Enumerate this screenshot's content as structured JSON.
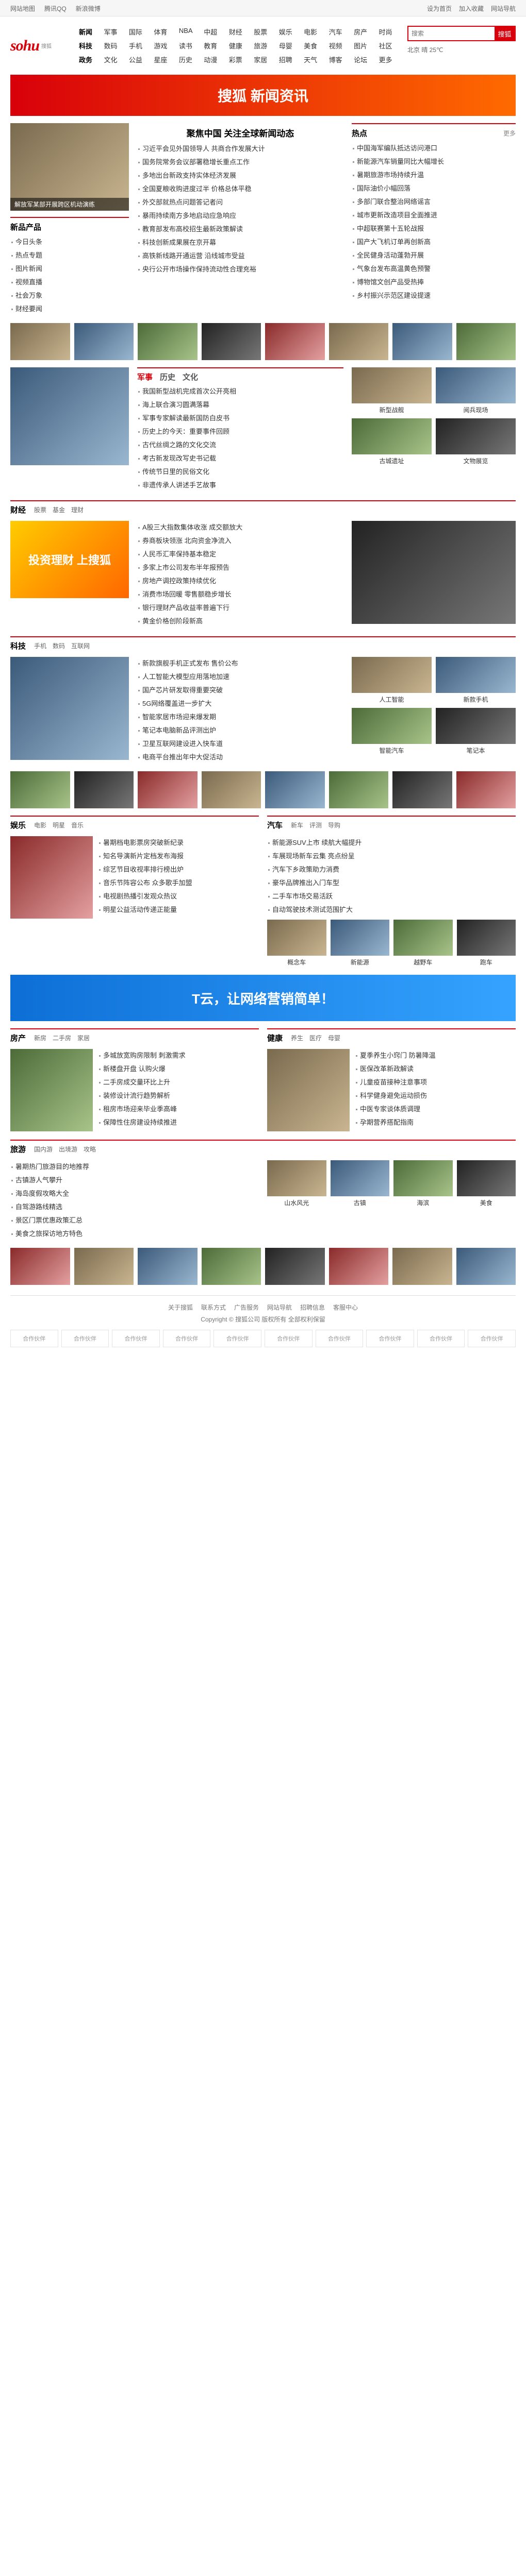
{
  "topbar": {
    "links": [
      "网站地图",
      "腾讯QQ",
      "新浪微博"
    ],
    "right": [
      "设为首页",
      "加入收藏",
      "网站导航"
    ]
  },
  "logo": {
    "mark": "sohu",
    "sub": "搜狐"
  },
  "nav": {
    "items": [
      "新闻",
      "军事",
      "国际",
      "体育",
      "NBA",
      "中超",
      "财经",
      "股票",
      "娱乐",
      "电影",
      "汽车",
      "房产",
      "时尚",
      "科技",
      "数码",
      "手机",
      "游戏",
      "读书",
      "教育",
      "健康",
      "旅游",
      "母婴",
      "美食",
      "视频",
      "图片",
      "社区",
      "政务",
      "文化",
      "公益",
      "星座",
      "历史",
      "动漫",
      "彩票",
      "家居",
      "招聘",
      "天气",
      "博客",
      "论坛",
      "更多"
    ]
  },
  "search": {
    "placeholder": "搜索",
    "button": "搜狐"
  },
  "weather": "北京 晴 25℃",
  "banner": "搜狐 新闻资讯",
  "top": {
    "focus_caption": "解放军某部开展跨区机动演练",
    "products_title": "新品产品",
    "left_links": [
      "今日头条",
      "热点专题",
      "图片新闻",
      "视频直播",
      "社会万象",
      "财经要闻"
    ],
    "headline": "聚焦中国 关注全球新闻动态",
    "news": [
      "习近平会见外国领导人 共商合作发展大计",
      "国务院常务会议部署稳增长重点工作",
      "多地出台新政支持实体经济发展",
      "全国夏粮收购进度过半 价格总体平稳",
      "外交部就热点问题答记者问",
      "暴雨持续南方多地启动应急响应",
      "教育部发布高校招生最新政策解读",
      "科技创新成果展在京开幕",
      "高铁新线路开通运营 沿线城市受益",
      "央行公开市场操作保持流动性合理充裕"
    ],
    "right_title": "热点",
    "right_more": "更多",
    "right_news": [
      "中国海军编队抵达访问港口",
      "新能源汽车销量同比大幅增长",
      "暑期旅游市场持续升温",
      "国际油价小幅回落",
      "多部门联合整治网络谣言",
      "城市更新改造项目全面推进",
      "中超联赛第十五轮战报",
      "国产大飞机订单再创新高",
      "全民健身活动蓬勃开展",
      "气象台发布高温黄色预警",
      "博物馆文创产品受热捧",
      "乡村振兴示范区建设提速"
    ]
  },
  "sec2": {
    "tabs": [
      "军事",
      "历史",
      "文化"
    ],
    "news": [
      "我国新型战机完成首次公开亮相",
      "海上联合演习圆满落幕",
      "军事专家解读最新国防白皮书",
      "历史上的今天：重要事件回顾",
      "古代丝绸之路的文化交流",
      "考古新发现改写史书记载",
      "传统节日里的民俗文化",
      "非遗传承人讲述手艺故事"
    ],
    "thumbs": [
      "新型战舰",
      "阅兵现场",
      "古城遗址",
      "文物展览"
    ]
  },
  "sec3": {
    "title": "财经",
    "tabs": [
      "股票",
      "基金",
      "理财"
    ],
    "news": [
      "A股三大指数集体收涨 成交额放大",
      "券商板块领涨 北向资金净流入",
      "人民币汇率保持基本稳定",
      "多家上市公司发布半年报预告",
      "房地产调控政策持续优化",
      "消费市场回暖 零售额稳步增长",
      "银行理财产品收益率普遍下行",
      "黄金价格创阶段新高"
    ],
    "ad": "投资理财 上搜狐"
  },
  "sec4": {
    "title": "科技",
    "tabs": [
      "手机",
      "数码",
      "互联网"
    ],
    "news": [
      "新款旗舰手机正式发布 售价公布",
      "人工智能大模型应用落地加速",
      "国产芯片研发取得重要突破",
      "5G网络覆盖进一步扩大",
      "智能家居市场迎来爆发期",
      "笔记本电脑新品评测出炉",
      "卫星互联网建设进入快车道",
      "电商平台推出年中大促活动"
    ],
    "thumbs": [
      "人工智能",
      "新款手机",
      "智能汽车",
      "笔记本"
    ]
  },
  "sec5": {
    "title": "娱乐",
    "tabs": [
      "电影",
      "明星",
      "音乐"
    ],
    "news": [
      "暑期档电影票房突破新纪录",
      "知名导演新片定档发布海报",
      "综艺节目收视率排行榜出炉",
      "音乐节阵容公布 众多歌手加盟",
      "电视剧热播引发观众热议",
      "明星公益活动传递正能量"
    ]
  },
  "sec6": {
    "title": "汽车",
    "tabs": [
      "新车",
      "评测",
      "导购"
    ],
    "news": [
      "新能源SUV上市 续航大幅提升",
      "车展现场新车云集 亮点纷呈",
      "汽车下乡政策助力消费",
      "豪华品牌推出入门车型",
      "二手车市场交易活跃",
      "自动驾驶技术测试范围扩大"
    ],
    "thumbs": [
      "概念车",
      "新能源",
      "越野车",
      "跑车"
    ]
  },
  "adbox": "T云，让网络营销简单！",
  "sec7": {
    "title": "房产",
    "tabs": [
      "新房",
      "二手房",
      "家居"
    ],
    "news": [
      "多城放宽购房限制 刺激需求",
      "新楼盘开盘 认购火爆",
      "二手房成交量环比上升",
      "装修设计流行趋势解析",
      "租房市场迎来毕业季高峰",
      "保障性住房建设持续推进"
    ]
  },
  "sec8": {
    "title": "健康",
    "tabs": [
      "养生",
      "医疗",
      "母婴"
    ],
    "news": [
      "夏季养生小窍门 防暑降温",
      "医保改革新政解读",
      "儿童疫苗接种注意事项",
      "科学健身避免运动损伤",
      "中医专家谈体质调理",
      "孕期营养搭配指南"
    ]
  },
  "sec9": {
    "title": "旅游",
    "tabs": [
      "国内游",
      "出境游",
      "攻略"
    ],
    "news": [
      "暑期热门旅游目的地推荐",
      "古镇游人气攀升",
      "海岛度假攻略大全",
      "自驾游路线精选",
      "景区门票优惠政策汇总",
      "美食之旅探访地方特色"
    ],
    "thumbs": [
      "山水风光",
      "古镇",
      "海滨",
      "美食"
    ]
  },
  "footer": {
    "links": [
      "关于搜狐",
      "联系方式",
      "广告服务",
      "网站导航",
      "招聘信息",
      "客服中心"
    ],
    "copy": "Copyright © 搜狐公司 版权所有 全部权利保留",
    "partners": [
      "合作伙伴",
      "合作伙伴",
      "合作伙伴",
      "合作伙伴",
      "合作伙伴",
      "合作伙伴",
      "合作伙伴",
      "合作伙伴",
      "合作伙伴",
      "合作伙伴"
    ]
  }
}
